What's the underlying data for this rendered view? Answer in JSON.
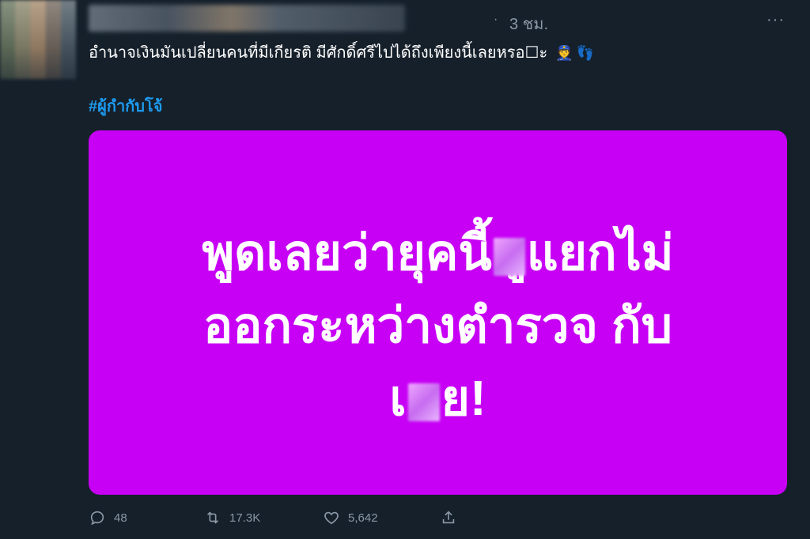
{
  "tweet": {
    "time_separator": "·",
    "time": "3 ชม.",
    "more_label": "···",
    "text": "อำนาจเงินมันเปลี่ยนคนที่มีเกียรติ มีศักดิ์ศรีไปได้ถึงเพียงนี้เลยหรอ☐ะ",
    "emoji_police": "👮",
    "emoji_feet": "👣",
    "hashtag": "#ผู้กำกับโจ้"
  },
  "media": {
    "background": "#c700f5",
    "line1_a": "พูดเลยว่ายุคนี้",
    "line1_b": "ูแยกไม่",
    "line2": "ออกระหว่างตำรวจ กับ",
    "line3_a": "เ",
    "line3_b": "ย!"
  },
  "actions": {
    "reply_count": "48",
    "retweet_count": "17.3K",
    "like_count": "5,642"
  },
  "colors": {
    "background": "#15202b",
    "hashtag": "#1d9bf0",
    "muted": "#8b98a5"
  }
}
